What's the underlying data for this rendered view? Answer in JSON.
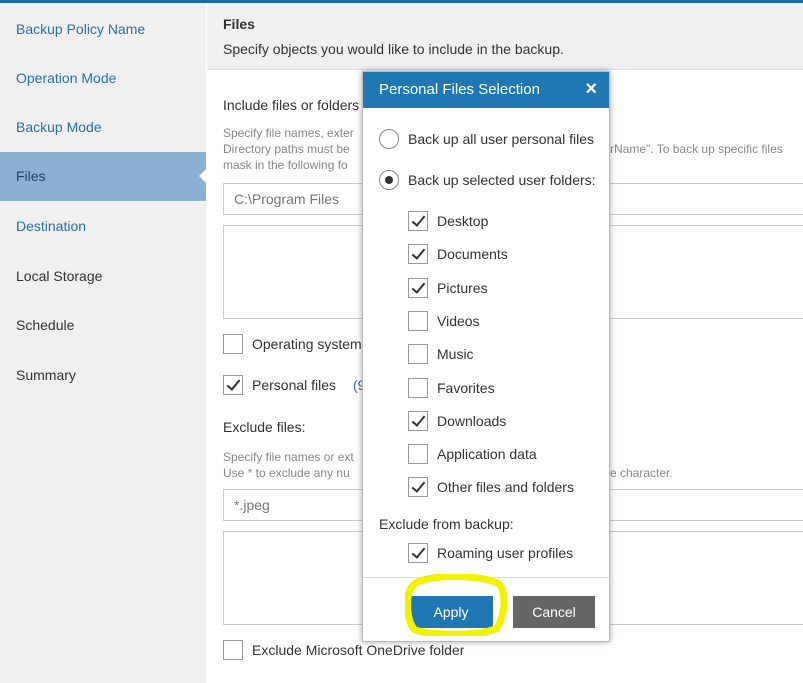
{
  "sidebar": {
    "items": [
      {
        "label": "Backup Policy Name"
      },
      {
        "label": "Operation Mode"
      },
      {
        "label": "Backup Mode"
      },
      {
        "label": "Files"
      },
      {
        "label": "Destination"
      },
      {
        "label": "Local Storage"
      },
      {
        "label": "Schedule"
      },
      {
        "label": "Summary"
      }
    ]
  },
  "header": {
    "title": "Files",
    "subtitle": "Specify objects you would like to include in the backup."
  },
  "include": {
    "label": "Include files or folders",
    "help_line1": "Specify file names, exter",
    "help_line2": "Directory paths must be",
    "help_line2b": "rName\". To back up specific files",
    "help_line3": "mask in the following fo",
    "input_value": "C:\\Program Files",
    "operating_system_label": "Operating system",
    "personal_files_label": "Personal files",
    "personal_files_count": "(9"
  },
  "exclude": {
    "label": "Exclude files:",
    "help_line1": "Specify file names or ext",
    "help_line2": "Use * to exclude any nu",
    "help_line2b": "e character.",
    "input_value": "*.jpeg",
    "onedrive_label": "Exclude Microsoft OneDrive folder"
  },
  "modal": {
    "title": "Personal Files Selection",
    "close_icon": "×",
    "radio_all": "Back up all user personal files",
    "radio_selected": "Back up selected user folders:",
    "folders": [
      {
        "label": "Desktop",
        "checked": true
      },
      {
        "label": "Documents",
        "checked": true
      },
      {
        "label": "Pictures",
        "checked": true
      },
      {
        "label": "Videos",
        "checked": false
      },
      {
        "label": "Music",
        "checked": false
      },
      {
        "label": "Favorites",
        "checked": false
      },
      {
        "label": "Downloads",
        "checked": true
      },
      {
        "label": "Application data",
        "checked": false
      },
      {
        "label": "Other files and folders",
        "checked": true
      }
    ],
    "exclude_label": "Exclude from backup:",
    "roaming_label": "Roaming user profiles",
    "apply_label": "Apply",
    "cancel_label": "Cancel"
  },
  "colors": {
    "accent": "#1f78b4",
    "sidebar_active": "#8bb1d2",
    "highlight": "#f2f200"
  }
}
